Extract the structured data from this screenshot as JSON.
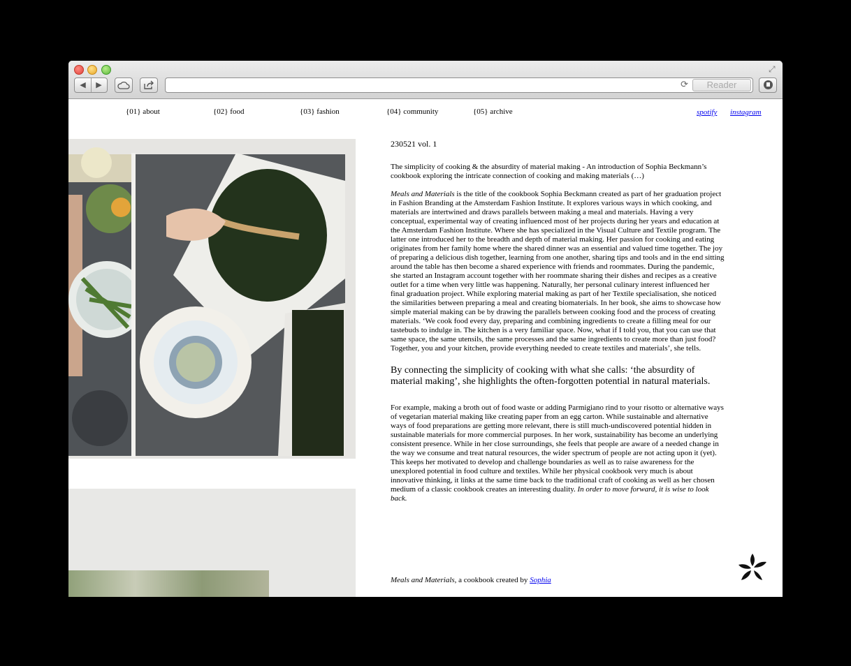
{
  "browser": {
    "reader_label": "Reader",
    "url": ""
  },
  "nav": {
    "items": [
      "{01} about",
      "{02} food",
      "{03} fashion",
      "{04} community",
      "{05} archive"
    ],
    "social": [
      "spotify",
      "instagram"
    ]
  },
  "article": {
    "issue": "230521  vol. 1",
    "intro": "The simplicity of cooking & the absurdity of material making - An introduction of Sophia Beckmann’s cookbook exploring the intricate connection of cooking and making materials (…)",
    "body1_title": "Meals and Materials",
    "body1": " is the title of the cookbook Sophia Beckmann created as part of her graduation project in Fashion Branding at the Amsterdam Fashion Institute. It explores various ways in which cooking, and materials are intertwined and draws parallels between making a meal and materials. Having a very conceptual, experimental way of creating influenced most of her projects during her years and education at the Amsterdam Fashion Institute. Where she has specialized in the Visual Culture and Textile program. The latter one introduced her to the breadth and depth of material making. Her passion for cooking and eating originates from her family home where the shared dinner was an essential and valued time together. The joy of preparing a delicious dish together, learning from one another, sharing tips and tools and in the end sitting around the table has then become a shared experience with friends and roommates. During the pandemic, she started an Instagram account together with her roommate sharing their dishes and recipes as a creative outlet for a time when very little was happening. Naturally, her personal culinary interest influenced her final graduation project. While exploring material making as part of her Textile specialisation, she noticed the similarities between preparing a meal and creating biomaterials. In her book, she aims to showcase how simple material making can be by drawing the parallels between cooking food and the process of creating materials. ‘We cook food every day, preparing and combining ingredients to create a filling meal for our tastebuds to indulge in. The kitchen is a very familiar space. Now, what if I told you, that you can use that same space, the same utensils, the same processes and the same ingredients to create more than just food? Together, you and your kitchen, provide everything needed to create textiles and materials’, she tells.",
    "quote": "By connecting the simplicity of cooking with what she calls: ‘the absurdity of material making’, she highlights the often-forgotten potential in natural materials.",
    "body2": "For example, making a broth out of food waste or adding Parmigiano rind to your risotto or alternative ways of vegetarian material making like creating paper from an egg carton. While sustainable and alternative ways of food preparations are getting more relevant, there is still much-undiscovered potential hidden in sustainable materials for more commercial purposes. In her work, sustainability has become an underlying consistent presence. While in her close surroundings, she feels that people are aware of a needed change in the way we consume and treat natural resources, the wider spectrum of people are not acting upon it (yet). This keeps her motivated to develop and challenge boundaries as well as to raise awareness for the unexplored potential in food culture and textiles. While her physical cookbook very much is about innovative thinking, it links at the same time back to the traditional craft of cooking as well as her chosen medium of a classic cookbook creates an interesting duality. ",
    "body2_closing": "In order to move forward, it is wise to look back."
  },
  "footer": {
    "title": "Meals and Materials",
    "text": ", a cookbook created by ",
    "link": "Sophia"
  }
}
